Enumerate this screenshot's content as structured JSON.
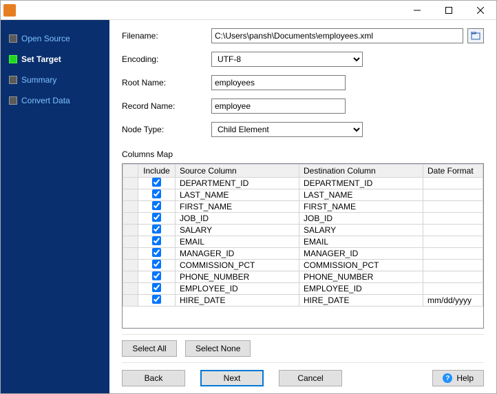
{
  "titlebar": {
    "title": ""
  },
  "sidebar": {
    "items": [
      {
        "label": "Open Source"
      },
      {
        "label": "Set Target"
      },
      {
        "label": "Summary"
      },
      {
        "label": "Convert Data"
      }
    ]
  },
  "form": {
    "filename_label": "Filename:",
    "filename_value": "C:\\Users\\pansh\\Documents\\employees.xml",
    "encoding_label": "Encoding:",
    "encoding_value": "UTF-8",
    "rootname_label": "Root Name:",
    "rootname_value": "employees",
    "recordname_label": "Record Name:",
    "recordname_value": "employee",
    "nodetype_label": "Node Type:",
    "nodetype_value": "Child Element"
  },
  "columns": {
    "label": "Columns Map",
    "headers": {
      "include": "Include",
      "source": "Source Column",
      "dest": "Destination Column",
      "datefmt": "Date Format"
    },
    "rows": [
      {
        "include": true,
        "source": "DEPARTMENT_ID",
        "dest": "DEPARTMENT_ID",
        "datefmt": ""
      },
      {
        "include": true,
        "source": "LAST_NAME",
        "dest": "LAST_NAME",
        "datefmt": ""
      },
      {
        "include": true,
        "source": "FIRST_NAME",
        "dest": "FIRST_NAME",
        "datefmt": ""
      },
      {
        "include": true,
        "source": "JOB_ID",
        "dest": "JOB_ID",
        "datefmt": ""
      },
      {
        "include": true,
        "source": "SALARY",
        "dest": "SALARY",
        "datefmt": ""
      },
      {
        "include": true,
        "source": "EMAIL",
        "dest": "EMAIL",
        "datefmt": ""
      },
      {
        "include": true,
        "source": "MANAGER_ID",
        "dest": "MANAGER_ID",
        "datefmt": ""
      },
      {
        "include": true,
        "source": "COMMISSION_PCT",
        "dest": "COMMISSION_PCT",
        "datefmt": ""
      },
      {
        "include": true,
        "source": "PHONE_NUMBER",
        "dest": "PHONE_NUMBER",
        "datefmt": ""
      },
      {
        "include": true,
        "source": "EMPLOYEE_ID",
        "dest": "EMPLOYEE_ID",
        "datefmt": ""
      },
      {
        "include": true,
        "source": "HIRE_DATE",
        "dest": "HIRE_DATE",
        "datefmt": "mm/dd/yyyy"
      }
    ]
  },
  "buttons": {
    "select_all": "Select All",
    "select_none": "Select None",
    "back": "Back",
    "next": "Next",
    "cancel": "Cancel",
    "help": "Help"
  }
}
